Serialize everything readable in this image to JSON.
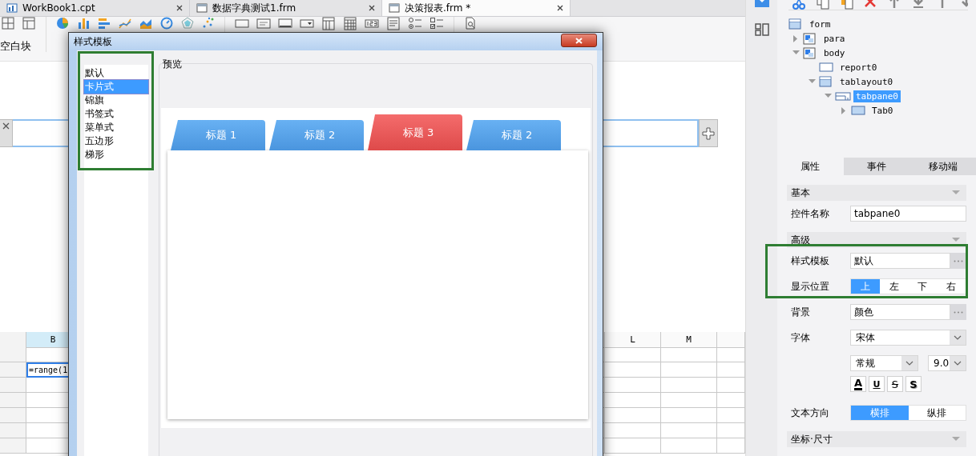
{
  "doc_tabs": [
    {
      "title": "WorkBook1.cpt",
      "kind": "cpt",
      "selected": false
    },
    {
      "title": "数据字典测试1.frm",
      "kind": "frm",
      "selected": false
    },
    {
      "title": "决策报表.frm *",
      "kind": "frm",
      "selected": true
    }
  ],
  "toolbar": {
    "block_label": "空白块"
  },
  "sheet": {
    "columns": [
      {
        "label": "B",
        "selected": true
      },
      {
        "label": "L",
        "selected": false
      },
      {
        "label": "M",
        "selected": false
      }
    ],
    "active_cell": "=range(1"
  },
  "dialog": {
    "title": "样式模板",
    "styles": [
      {
        "label": "默认",
        "selected": false
      },
      {
        "label": "卡片式",
        "selected": true
      },
      {
        "label": "锦旗",
        "selected": false
      },
      {
        "label": "书签式",
        "selected": false
      },
      {
        "label": "菜单式",
        "selected": false
      },
      {
        "label": "五边形",
        "selected": false
      },
      {
        "label": "梯形",
        "selected": false
      }
    ],
    "preview_label": "预览",
    "preview_tabs": [
      {
        "label": "标题 1",
        "selected": false
      },
      {
        "label": "标题 2",
        "selected": false
      },
      {
        "label": "标题 3",
        "selected": true
      },
      {
        "label": "标题 2",
        "selected": false
      }
    ]
  },
  "tree": {
    "label": "form",
    "kind": "form",
    "selected": false,
    "children": [
      {
        "label": "para",
        "kind": "block",
        "selected": false,
        "expanded": false
      },
      {
        "label": "body",
        "kind": "block",
        "selected": false,
        "expanded": true,
        "children": [
          {
            "label": "report0",
            "kind": "report",
            "selected": false
          },
          {
            "label": "tablayout0",
            "kind": "form",
            "selected": false,
            "expanded": true,
            "children": [
              {
                "label": "tabpane0",
                "kind": "tabpane",
                "selected": true,
                "expanded": true,
                "children": [
                  {
                    "label": "Tab0",
                    "kind": "tab",
                    "selected": false,
                    "expanded": false
                  }
                ]
              }
            ]
          }
        ]
      }
    ]
  },
  "prop_tabs": [
    {
      "label": "属性",
      "selected": true
    },
    {
      "label": "事件",
      "selected": false
    },
    {
      "label": "移动端",
      "selected": false
    }
  ],
  "props": [
    {
      "kind": "section",
      "label": "基本"
    },
    {
      "kind": "text",
      "label": "控件名称",
      "value": "tabpane0"
    },
    {
      "kind": "section",
      "label": "高级"
    },
    {
      "kind": "picker",
      "label": "样式模板",
      "value": "默认"
    },
    {
      "kind": "segmented",
      "label": "显示位置",
      "options": [
        {
          "label": "上",
          "selected": true
        },
        {
          "label": "左",
          "selected": false
        },
        {
          "label": "下",
          "selected": false
        },
        {
          "label": "右",
          "selected": false
        }
      ]
    },
    {
      "kind": "picker",
      "label": "背景",
      "value": "颜色"
    },
    {
      "kind": "select",
      "label": "字体",
      "value": "宋体"
    },
    {
      "kind": "font_style",
      "style": "常规",
      "size": "9.0",
      "buttons": [
        {
          "label": "A",
          "kind": "color"
        },
        {
          "label": "U",
          "kind": "underline"
        },
        {
          "label": "S",
          "kind": "strike"
        },
        {
          "label": "S",
          "kind": "shadow"
        }
      ]
    },
    {
      "kind": "segmented",
      "label": "文本方向",
      "options": [
        {
          "label": "横排",
          "selected": true
        },
        {
          "label": "纵排",
          "selected": false
        }
      ]
    },
    {
      "kind": "section",
      "label": "坐标·尺寸"
    }
  ]
}
